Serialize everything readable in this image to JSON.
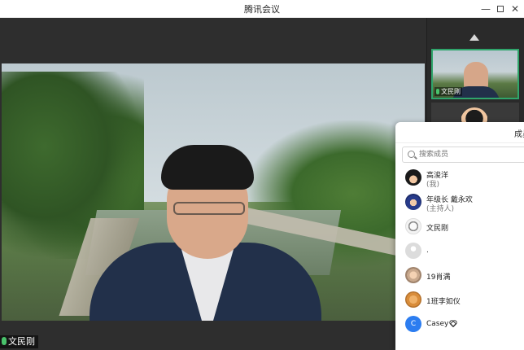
{
  "window": {
    "title": "腾讯会议",
    "minimize": "—",
    "close": "✕"
  },
  "main_video": {
    "participant_name": "文民刚"
  },
  "thumbnail": {
    "participant_name": "文民刚"
  },
  "members_panel": {
    "title": "成员",
    "search_placeholder": "搜索成员",
    "members": [
      {
        "name": "高浚洋",
        "role": "(我)",
        "avatar": "goku-avatar"
      },
      {
        "name": "年级长 戴永欢",
        "role": "(主持人)",
        "avatar": "kid-avatar"
      },
      {
        "name": "文民刚",
        "role": "",
        "avatar": "cartoon-avatar"
      },
      {
        "name": ".",
        "role": "",
        "avatar": "default-avatar"
      },
      {
        "name": "19肖满",
        "role": "",
        "avatar": "baby-avatar"
      },
      {
        "name": "1班李如仪",
        "role": "",
        "avatar": "cat-avatar"
      },
      {
        "name": "Casey",
        "role": "",
        "avatar": "letter-avatar",
        "avatar_letter": "C"
      }
    ]
  },
  "colors": {
    "accent_green": "#2fa56b",
    "mic_green": "#49c26b",
    "letter_avatar_blue": "#2c7df0"
  }
}
